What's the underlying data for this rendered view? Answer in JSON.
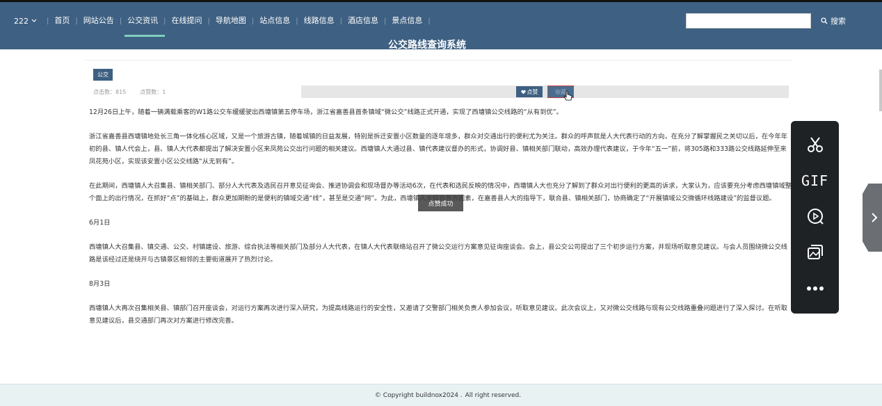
{
  "nav": {
    "user": "222",
    "items": [
      "首页",
      "网站公告",
      "公交资讯",
      "在线提问",
      "导航地图",
      "站点信息",
      "线路信息",
      "酒店信息",
      "景点信息"
    ],
    "active_index": 2
  },
  "search": {
    "placeholder": "",
    "button_label": "搜索"
  },
  "site_title": "公交路线查询系统",
  "article": {
    "tag": "公交",
    "clicks_label": "点击数：815",
    "likes_label": "点赞数：1",
    "like_button": "点赞",
    "fav_button": "收藏",
    "paragraphs": [
      "12月26日上午，随着一辆满载乘客的W1路公交车缓缓驶出西塘镇第五停车场，浙江省嘉善县首条镇域“微公交”线路正式开通，实现了西塘镇公交线路的“从有到优”。",
      "浙江省嘉善县西塘镇地处长三角一体化核心区域，又是一个旅游古镇，随着城镇的日益发展，特别是拆迁安置小区数量的逐年增多，群众对交通出行的便利尤为关注。群众的呼声就是人大代表行动的方向，在充分了解掌握民之关切以后，在今年年初的县、镇人代会上，县、镇人大代表都提出了解决安置小区来凤苑公交出行问题的相关建议。西塘镇人大通过县、镇代表建议督办的形式，协调好县、镇相关部门联动，高效办理代表建议，于今年“五一”前，将305路和333路公交线路延伸至来凤花苑小区，实现该安置小区公交线路“从无到有”。",
      "在此期间，西塘镇人大召集县、镇相关部门、部分人大代表及选民召开意见征询会、推进协调会和现场督办等活动6次，在代表和选民反映的情况中，西塘镇人大也充分了解到了群众对出行便利的更高的诉求，大家认为，应该要充分考虑西塘镇域整个面上的出行情况，在抓好“点”的基础上，群众更加期盼的是便利的镇域交通“线”，甚至是交通“网”。为此，西塘镇人大综合各方因素，在嘉善县人大的指导下，联合县、镇相关部门，协商确定了“开展镇域公交微循环线路建设”的监督议题。",
      "6月1日",
      "西塘镇人大召集县、镇交通、公交、村镇建设、旅游、综合执法等相关部门及部分人大代表，在镇人大代表联络站召开了微公交运行方案意见征询座谈会。会上，县公交公司提出了三个初步运行方案，并现场听取意见建议。与会人员围绕微公交线路是该经过还是绕开与古镇景区相邻的主要街道展开了热烈讨论。",
      "8月3日",
      "西塘镇人大再次召集相关县、镇部门召开座谈会，对运行方案再次进行深入研究，为提高线路运行的安全性，又邀请了交警部门相关负责人参加会议，听取意见建议。此次会议上，又对微公交线路与现有公交线路重叠问题进行了深入探讨。在听取意见建议后，县交通部门再次对方案进行修改完善。"
    ]
  },
  "toast": "点赞成功",
  "toolbar": {
    "gif_label": "GIF"
  },
  "footer": {
    "copyright": "© Copyright buildnox2024 .",
    "rights": "All right reserved."
  },
  "colors": {
    "header": "#3e6082",
    "accent": "#7fcfc0",
    "toolbar": "#1f2225"
  }
}
